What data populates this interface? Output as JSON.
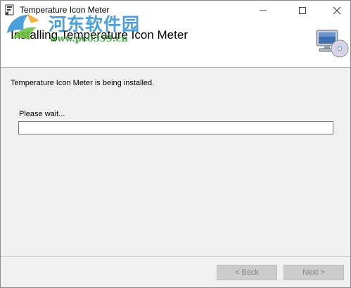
{
  "window": {
    "title": "Temperature Icon Meter",
    "app_icon": "installer-icon"
  },
  "titlebar_controls": {
    "minimize_icon": "minimize-icon",
    "maximize_icon": "maximize-icon",
    "close_icon": "close-icon"
  },
  "header": {
    "title": "Installing Temperature Icon Meter",
    "icon": "computer-cd-icon"
  },
  "watermark": {
    "logo": "watermark-logo-icon",
    "text_cn": "河东软件园",
    "url": "www.pc0359.cn"
  },
  "body": {
    "status": "Temperature Icon Meter is being installed.",
    "wait_label": "Please wait...",
    "progress": 0
  },
  "buttons": {
    "back": "< Back",
    "next": "Next >"
  },
  "colors": {
    "progress_fill": "#06b025",
    "watermark_blue": "#2f8fd6",
    "watermark_green": "#2e9a2e"
  }
}
